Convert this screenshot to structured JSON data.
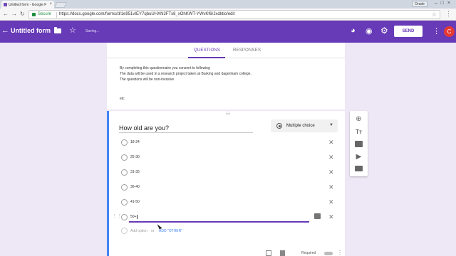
{
  "browser": {
    "tab_title": "Untitled form - Google F",
    "user_badge": "Orade",
    "secure_label": "Secure",
    "url": "https://docs.google.com/forms/d/1e951vIEY7qbuUHXN3FTx8_xOhKWT-YWvKf6rJxdktio/edit"
  },
  "header": {
    "form_title": "Untitled form",
    "saving_text": "Saving...",
    "send_label": "SEND",
    "avatar_letter": "C",
    "colors": {
      "primary": "#673ab7",
      "background": "#ede7f6",
      "accent_blue": "#4285f4"
    }
  },
  "tabs": {
    "questions": "QUESTIONS",
    "responses": "RESPONSES"
  },
  "description": {
    "line1": "By completing this questionnaire you consent to following",
    "line2": "The data will be used in a research project taken at Barking and dagenham college.",
    "line3": "The questions will be non-invasive",
    "line4": "etc"
  },
  "question": {
    "title": "How old are you?",
    "type": "Multiple choice",
    "options": [
      "18-24",
      "25-30",
      "31-35",
      "36-40",
      "41-50",
      "50+"
    ],
    "add_option": "Add option",
    "or": "or",
    "add_other": "ADD \"OTHER\"",
    "required_label": "Required"
  }
}
